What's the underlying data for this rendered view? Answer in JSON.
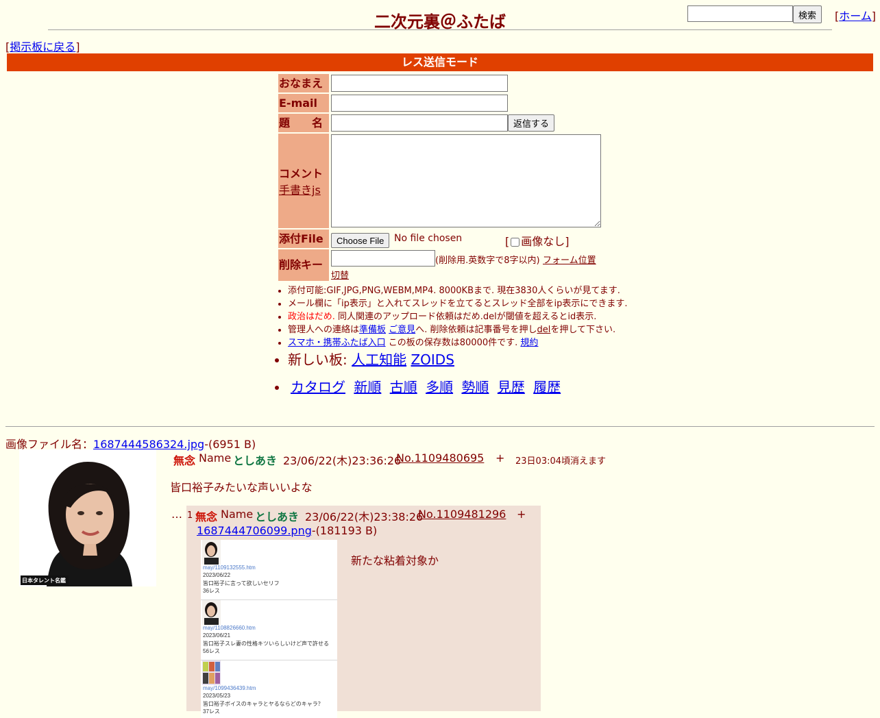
{
  "header": {
    "title": "二次元裏＠ふたば",
    "search_button": "検索",
    "home_link": "ホーム",
    "back_link": "掲示板に戻る"
  },
  "mode_bar": "レス送信モード",
  "form": {
    "name_label": "おなまえ",
    "email_label": "E-mail",
    "subject_label": "題　　名",
    "reply_button": "返信する",
    "comment_label": "コメント",
    "handwrite_link": "手書きjs",
    "file_label": "添付File",
    "choose_file_button": "Choose File",
    "no_file_text": "No file chosen",
    "no_image_label": "画像なし",
    "delete_key_label": "削除キー",
    "delete_note": "(削除用.英数字で8字以内)",
    "form_switch_link_1": "フォーム位置",
    "form_switch_link_2": "切替"
  },
  "rules": {
    "r1": "添付可能:GIF,JPG,PNG,WEBM,MP4. 8000KBまで. 現在3830人くらいが見てます.",
    "r2": "メール欄に「ip表示」と入れてスレッドを立てるとスレッド全部をip表示にできます.",
    "r3_politics": "政治はだめ.",
    "r3_rest": " 同人関連のアップロード依頼はだめ.delが閾値を超えるとid表示.",
    "r4_a": "管理人への連絡は",
    "r4_link1": "準備板",
    "r4_link2": "ご意見",
    "r4_b": "へ. 削除依頼は記事番号を押し",
    "r4_link3": "del",
    "r4_c": "を押して下さい.",
    "r5_link": "スマホ・携帯ふたば入口",
    "r5_text": " この板の保存数は80000件です.",
    "r5_link2": "規約",
    "new_boards_label": "新しい板:",
    "new_board_1": "人工知能",
    "new_board_2": "ZOIDS",
    "nav": [
      "カタログ",
      "新順",
      "古順",
      "多順",
      "勢順",
      "見歴",
      "履歴"
    ]
  },
  "op": {
    "file_label": "画像ファイル名：",
    "file_name": "1687444586324.jpg",
    "file_size": "-(6951 B)",
    "thumb_caption": "日本タレント名鑑",
    "subject": "無念",
    "name_label": "Name",
    "name": "としあき",
    "datetime": "23/06/22(木)23:36:26",
    "number": "No.1109480695",
    "plus": "+",
    "expire": "23日03:04頃消えます",
    "body": "皆口裕子みたいな声いいよな"
  },
  "reply": {
    "dots": "…",
    "index": "1",
    "subject": "無念",
    "name_label": "Name",
    "name": "としあき",
    "datetime": "23/06/22(木)23:38:26",
    "number": "No.1109481296",
    "plus": "+",
    "file_name": "1687444706099.png",
    "file_size": "-(181193 B)",
    "body": "新たな粘着対象か",
    "thumb_items": [
      {
        "link": "may/1109132555.htm",
        "date": "2023/06/22",
        "title": "皆口裕子に言って欲しいセリフ",
        "count": "36レス"
      },
      {
        "link": "may/1108826660.htm",
        "date": "2023/06/21",
        "title": "皆口裕子スレ妻の性格キツいらしいけど声で許せる",
        "count": "56レス"
      },
      {
        "link": "may/1099436439.htm",
        "date": "2023/05/23",
        "title": "皆口裕子ボイスのキャラとヤるならどのキャラ？",
        "count": "37レス"
      }
    ]
  }
}
